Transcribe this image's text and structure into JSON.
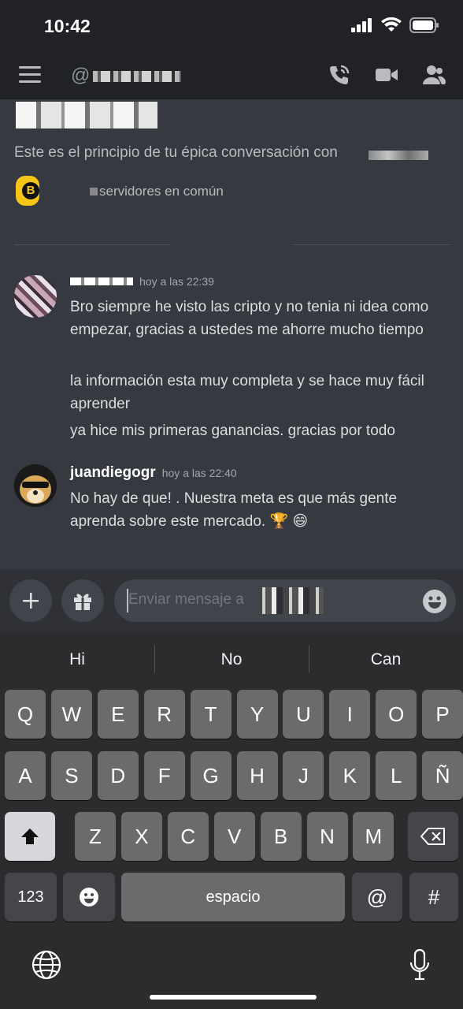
{
  "status": {
    "time": "10:42"
  },
  "topbar": {
    "at_symbol": "@"
  },
  "intro": {
    "conversation_text": "Este es el principio de tu épica conversación con",
    "common_servers": "servidores en común"
  },
  "messages": [
    {
      "timestamp": "hoy a las 22:39",
      "lines": [
        "Bro siempre he visto las cripto y no tenia ni idea como empezar, gracias a ustedes me ahorre mucho tiempo",
        "la información esta muy completa y se hace muy fácil aprender",
        "ya hice mis primeras ganancias. gracias por todo"
      ]
    },
    {
      "author": "juandiegogr",
      "timestamp": "hoy a las 22:40",
      "lines": [
        "No hay de que! . Nuestra meta es que más gente aprenda sobre este mercado. 🏆 😄"
      ]
    }
  ],
  "composer": {
    "placeholder": "Enviar mensaje a"
  },
  "keyboard": {
    "suggestions": [
      "Hi",
      "No",
      "Can"
    ],
    "row1": [
      "Q",
      "W",
      "E",
      "R",
      "T",
      "Y",
      "U",
      "I",
      "O",
      "P"
    ],
    "row2": [
      "A",
      "S",
      "D",
      "F",
      "G",
      "H",
      "J",
      "K",
      "L",
      "Ñ"
    ],
    "row3": [
      "Z",
      "X",
      "C",
      "V",
      "B",
      "N",
      "M"
    ],
    "numbers_key": "123",
    "space_key": "espacio",
    "at_key": "@",
    "hash_key": "#"
  },
  "icons": [
    "hamburger-menu-icon",
    "phone-call-icon",
    "video-camera-icon",
    "members-icon",
    "plus-icon",
    "gift-icon",
    "emoji-icon",
    "shift-icon",
    "backspace-icon",
    "globe-icon",
    "microphone-icon",
    "signal-icon",
    "wifi-icon",
    "battery-icon"
  ]
}
